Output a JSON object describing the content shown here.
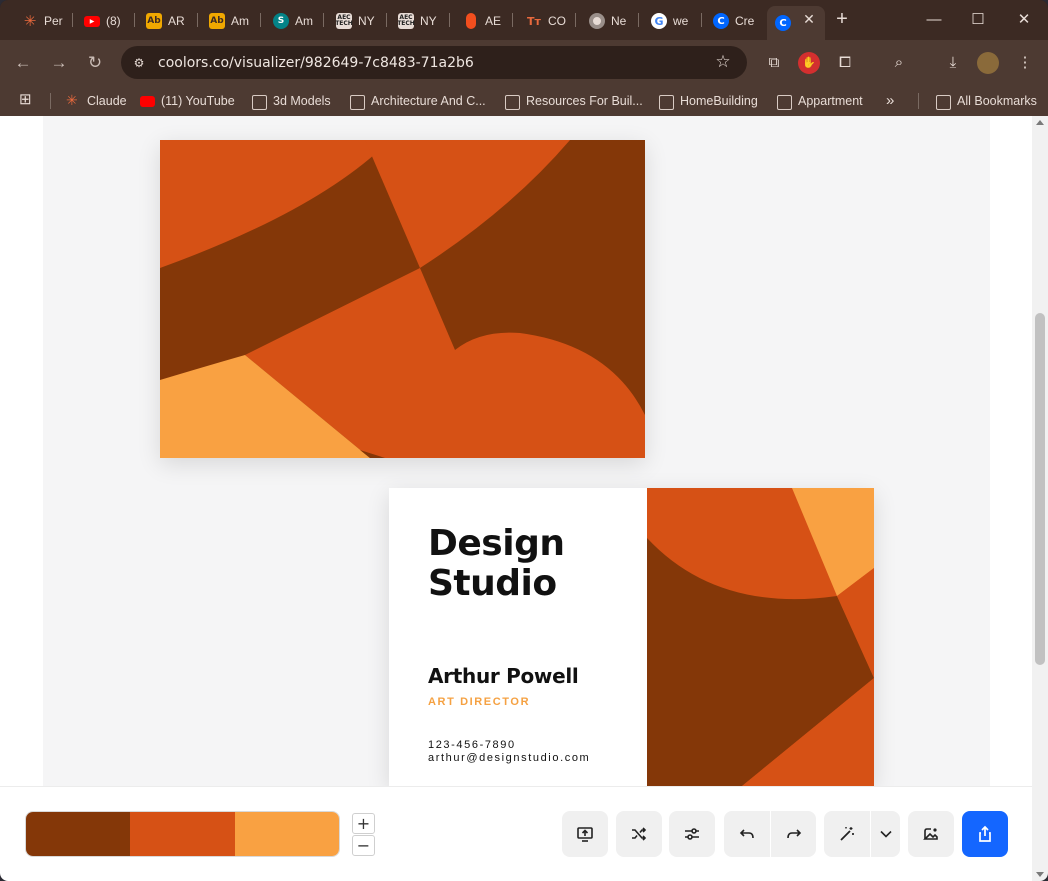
{
  "tabs": [
    {
      "title": "Per",
      "icon": "claude-icon"
    },
    {
      "title": "(8)",
      "icon": "youtube-icon"
    },
    {
      "title": "AR",
      "icon": "adobe-stock-icon"
    },
    {
      "title": "Am",
      "icon": "adobe-stock-icon"
    },
    {
      "title": "Am",
      "icon": "sharepoint-icon"
    },
    {
      "title": "NY",
      "icon": "aec-tech-icon"
    },
    {
      "title": "NY",
      "icon": "aec-tech-icon"
    },
    {
      "title": "AE",
      "icon": "figma-icon"
    },
    {
      "title": "CO",
      "icon": "tt-icon"
    },
    {
      "title": "Ne",
      "icon": "chrome-icon"
    },
    {
      "title": "we",
      "icon": "google-icon"
    },
    {
      "title": "Cre",
      "icon": "coolors-icon"
    }
  ],
  "address_bar": {
    "url": "coolors.co/visualizer/982649-7c8483-71a2b6"
  },
  "bookmarks": [
    {
      "label": "Claude",
      "icon": "claude-icon"
    },
    {
      "label": "(11) YouTube",
      "icon": "youtube-icon"
    },
    {
      "label": "3d Models",
      "icon": "folder-icon"
    },
    {
      "label": "Architecture And C...",
      "icon": "folder-icon"
    },
    {
      "label": "Resources For Buil...",
      "icon": "folder-icon"
    },
    {
      "label": "HomeBuilding",
      "icon": "folder-icon"
    },
    {
      "label": "Appartment",
      "icon": "folder-icon"
    }
  ],
  "bookmarks_overflow": "»",
  "all_bookmarks": "All Bookmarks",
  "card": {
    "title": "Design\nStudio",
    "name": "Arthur Powell",
    "role": "ART DIRECTOR",
    "phone": "123-456-7890",
    "email": "arthur@designstudio.com"
  },
  "palette": {
    "colors": [
      "#843708",
      "#d65115",
      "#f9a142"
    ]
  },
  "zoom": {
    "plus": "+",
    "minus": "−"
  },
  "colors": {
    "dark": "#843708",
    "mid": "#d65115",
    "light": "#f9a142",
    "primary_button": "#1466ff"
  }
}
